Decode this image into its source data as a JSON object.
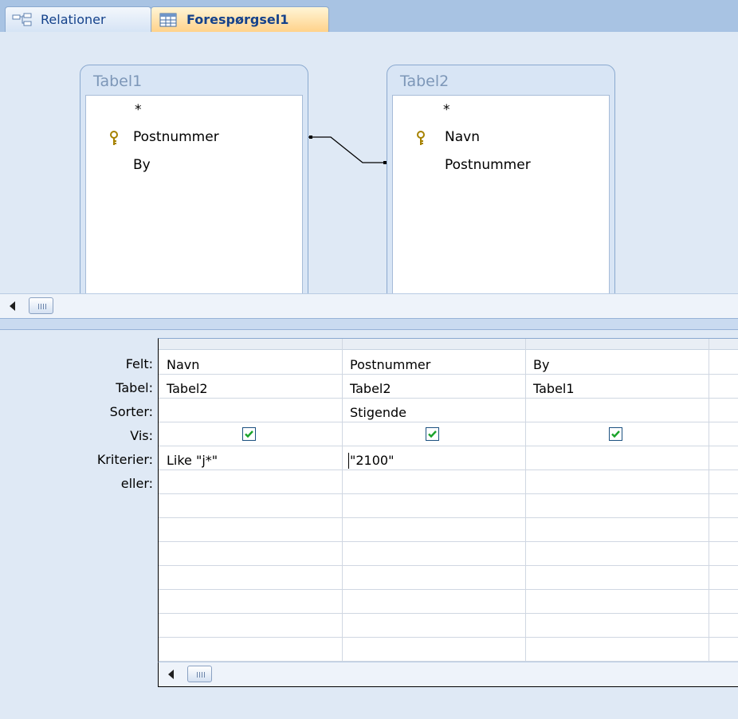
{
  "tabs": [
    {
      "label": "Relationer",
      "icon": "relationships-icon",
      "active": false
    },
    {
      "label": "Forespørgsel1",
      "icon": "query-icon",
      "active": true
    }
  ],
  "tables": [
    {
      "title": "Tabel1",
      "fields": [
        "*",
        "Postnummer",
        "By"
      ],
      "key_field": "Postnummer"
    },
    {
      "title": "Tabel2",
      "fields": [
        "*",
        "Navn",
        "Postnummer"
      ],
      "key_field": "Navn"
    }
  ],
  "grid": {
    "row_labels": [
      "Felt:",
      "Tabel:",
      "Sorter:",
      "Vis:",
      "Kriterier:",
      "eller:"
    ],
    "columns": [
      {
        "felt": "Navn",
        "tabel": "Tabel2",
        "sorter": "",
        "vis": true,
        "kriterier": "Like \"j*\"",
        "eller": ""
      },
      {
        "felt": "Postnummer",
        "tabel": "Tabel2",
        "sorter": "Stigende",
        "vis": true,
        "kriterier": "\"2100\"",
        "eller": ""
      },
      {
        "felt": "By",
        "tabel": "Tabel1",
        "sorter": "",
        "vis": true,
        "kriterier": "",
        "eller": ""
      }
    ]
  },
  "colors": {
    "active_tab": "#ffd28a",
    "check": "#1aa32a",
    "accent": "#15428b"
  }
}
